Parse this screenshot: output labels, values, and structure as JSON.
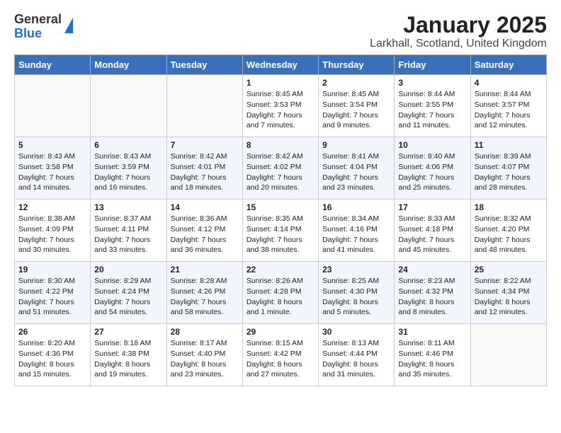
{
  "logo": {
    "general": "General",
    "blue": "Blue"
  },
  "title": "January 2025",
  "subtitle": "Larkhall, Scotland, United Kingdom",
  "headers": [
    "Sunday",
    "Monday",
    "Tuesday",
    "Wednesday",
    "Thursday",
    "Friday",
    "Saturday"
  ],
  "weeks": [
    [
      {
        "day": "",
        "info": ""
      },
      {
        "day": "",
        "info": ""
      },
      {
        "day": "",
        "info": ""
      },
      {
        "day": "1",
        "info": "Sunrise: 8:45 AM\nSunset: 3:53 PM\nDaylight: 7 hours\nand 7 minutes."
      },
      {
        "day": "2",
        "info": "Sunrise: 8:45 AM\nSunset: 3:54 PM\nDaylight: 7 hours\nand 9 minutes."
      },
      {
        "day": "3",
        "info": "Sunrise: 8:44 AM\nSunset: 3:55 PM\nDaylight: 7 hours\nand 11 minutes."
      },
      {
        "day": "4",
        "info": "Sunrise: 8:44 AM\nSunset: 3:57 PM\nDaylight: 7 hours\nand 12 minutes."
      }
    ],
    [
      {
        "day": "5",
        "info": "Sunrise: 8:43 AM\nSunset: 3:58 PM\nDaylight: 7 hours\nand 14 minutes."
      },
      {
        "day": "6",
        "info": "Sunrise: 8:43 AM\nSunset: 3:59 PM\nDaylight: 7 hours\nand 16 minutes."
      },
      {
        "day": "7",
        "info": "Sunrise: 8:42 AM\nSunset: 4:01 PM\nDaylight: 7 hours\nand 18 minutes."
      },
      {
        "day": "8",
        "info": "Sunrise: 8:42 AM\nSunset: 4:02 PM\nDaylight: 7 hours\nand 20 minutes."
      },
      {
        "day": "9",
        "info": "Sunrise: 8:41 AM\nSunset: 4:04 PM\nDaylight: 7 hours\nand 23 minutes."
      },
      {
        "day": "10",
        "info": "Sunrise: 8:40 AM\nSunset: 4:06 PM\nDaylight: 7 hours\nand 25 minutes."
      },
      {
        "day": "11",
        "info": "Sunrise: 8:39 AM\nSunset: 4:07 PM\nDaylight: 7 hours\nand 28 minutes."
      }
    ],
    [
      {
        "day": "12",
        "info": "Sunrise: 8:38 AM\nSunset: 4:09 PM\nDaylight: 7 hours\nand 30 minutes."
      },
      {
        "day": "13",
        "info": "Sunrise: 8:37 AM\nSunset: 4:11 PM\nDaylight: 7 hours\nand 33 minutes."
      },
      {
        "day": "14",
        "info": "Sunrise: 8:36 AM\nSunset: 4:12 PM\nDaylight: 7 hours\nand 36 minutes."
      },
      {
        "day": "15",
        "info": "Sunrise: 8:35 AM\nSunset: 4:14 PM\nDaylight: 7 hours\nand 38 minutes."
      },
      {
        "day": "16",
        "info": "Sunrise: 8:34 AM\nSunset: 4:16 PM\nDaylight: 7 hours\nand 41 minutes."
      },
      {
        "day": "17",
        "info": "Sunrise: 8:33 AM\nSunset: 4:18 PM\nDaylight: 7 hours\nand 45 minutes."
      },
      {
        "day": "18",
        "info": "Sunrise: 8:32 AM\nSunset: 4:20 PM\nDaylight: 7 hours\nand 48 minutes."
      }
    ],
    [
      {
        "day": "19",
        "info": "Sunrise: 8:30 AM\nSunset: 4:22 PM\nDaylight: 7 hours\nand 51 minutes."
      },
      {
        "day": "20",
        "info": "Sunrise: 8:29 AM\nSunset: 4:24 PM\nDaylight: 7 hours\nand 54 minutes."
      },
      {
        "day": "21",
        "info": "Sunrise: 8:28 AM\nSunset: 4:26 PM\nDaylight: 7 hours\nand 58 minutes."
      },
      {
        "day": "22",
        "info": "Sunrise: 8:26 AM\nSunset: 4:28 PM\nDaylight: 8 hours\nand 1 minute."
      },
      {
        "day": "23",
        "info": "Sunrise: 8:25 AM\nSunset: 4:30 PM\nDaylight: 8 hours\nand 5 minutes."
      },
      {
        "day": "24",
        "info": "Sunrise: 8:23 AM\nSunset: 4:32 PM\nDaylight: 8 hours\nand 8 minutes."
      },
      {
        "day": "25",
        "info": "Sunrise: 8:22 AM\nSunset: 4:34 PM\nDaylight: 8 hours\nand 12 minutes."
      }
    ],
    [
      {
        "day": "26",
        "info": "Sunrise: 8:20 AM\nSunset: 4:36 PM\nDaylight: 8 hours\nand 15 minutes."
      },
      {
        "day": "27",
        "info": "Sunrise: 8:18 AM\nSunset: 4:38 PM\nDaylight: 8 hours\nand 19 minutes."
      },
      {
        "day": "28",
        "info": "Sunrise: 8:17 AM\nSunset: 4:40 PM\nDaylight: 8 hours\nand 23 minutes."
      },
      {
        "day": "29",
        "info": "Sunrise: 8:15 AM\nSunset: 4:42 PM\nDaylight: 8 hours\nand 27 minutes."
      },
      {
        "day": "30",
        "info": "Sunrise: 8:13 AM\nSunset: 4:44 PM\nDaylight: 8 hours\nand 31 minutes."
      },
      {
        "day": "31",
        "info": "Sunrise: 8:11 AM\nSunset: 4:46 PM\nDaylight: 8 hours\nand 35 minutes."
      },
      {
        "day": "",
        "info": ""
      }
    ]
  ]
}
